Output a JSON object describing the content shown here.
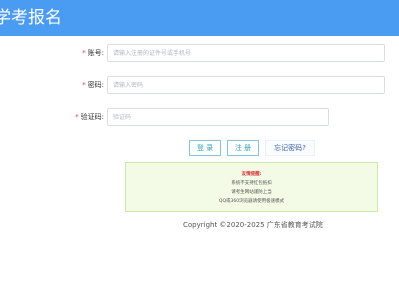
{
  "header": {
    "title": "学考报名"
  },
  "form": {
    "account": {
      "label": "账号:",
      "placeholder": "请输入注册的证件号或手机号"
    },
    "password": {
      "label": "密码:",
      "placeholder": "请输入密码"
    },
    "captcha": {
      "label": "验证码:",
      "placeholder": "验证码"
    },
    "required_mark": "*"
  },
  "buttons": {
    "login": "登 录",
    "register": "注 册",
    "forgot": "忘记密码?"
  },
  "notice": {
    "title": "友情提醒:",
    "lines": [
      "系统不支持红包抵扣",
      "请考生网站谨防上当",
      "QQ或360浏览器请使用极速模式"
    ]
  },
  "footer": {
    "copyright": "Copyright ©2020-2025 广东省教育考试院"
  },
  "colors": {
    "header_bg": "#4a9bf2",
    "required": "#e4393c",
    "button_border": "#7fc9d6",
    "notice_bg": "#f3fbe6",
    "notice_border": "#cfe7a6",
    "notice_title": "#d9363e"
  }
}
